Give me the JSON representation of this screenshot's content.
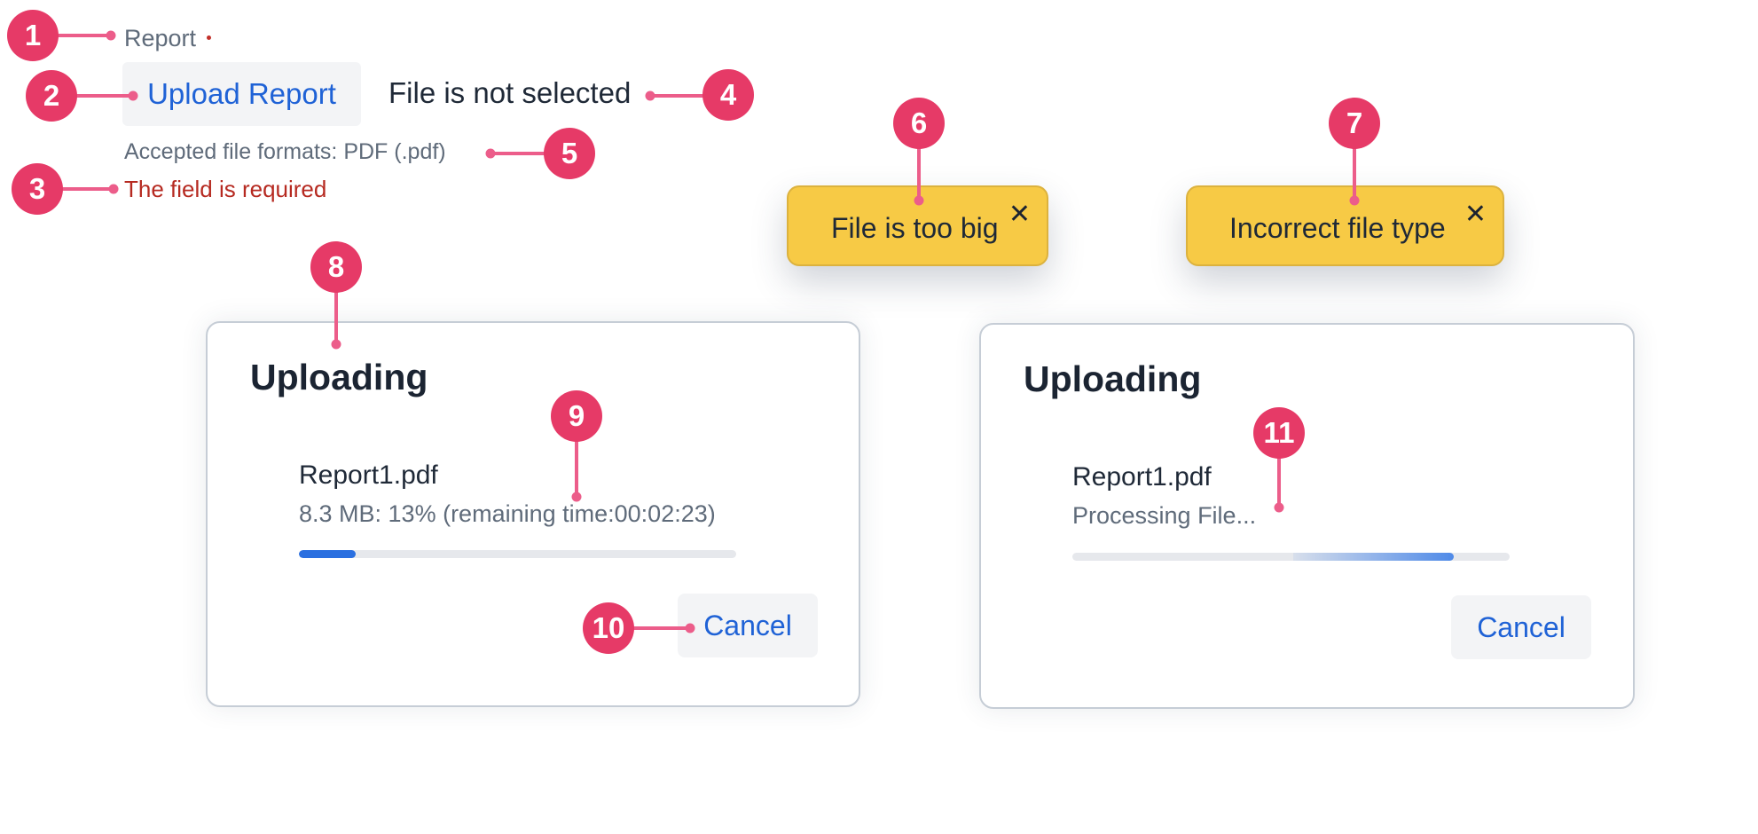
{
  "form": {
    "field_label": "Report",
    "required_indicator_color": "#c2302a",
    "upload_button_label": "Upload Report",
    "file_status": "File is not selected",
    "accepted_formats": "Accepted file formats: PDF (.pdf)",
    "error_message": "The field is required"
  },
  "toasts": [
    {
      "message": "File is too big",
      "close_icon": "close-icon"
    },
    {
      "message": "Incorrect file type",
      "close_icon": "close-icon"
    }
  ],
  "dialogs": [
    {
      "title": "Uploading",
      "file_name": "Report1.pdf",
      "status": "8.3 MB: 13% (remaining time:00:02:23)",
      "progress_percent": 13,
      "progress_mode": "determinate",
      "cancel_label": "Cancel"
    },
    {
      "title": "Uploading",
      "file_name": "Report1.pdf",
      "status": "Processing File...",
      "progress_mode": "indeterminate",
      "cancel_label": "Cancel"
    }
  ],
  "annotations": [
    "1",
    "2",
    "3",
    "4",
    "5",
    "6",
    "7",
    "8",
    "9",
    "10",
    "11"
  ],
  "colors": {
    "accent_blue": "#1f62d6",
    "error_red": "#b62a21",
    "toast_yellow": "#f7ca45",
    "annotation_pink": "#e63a67"
  }
}
